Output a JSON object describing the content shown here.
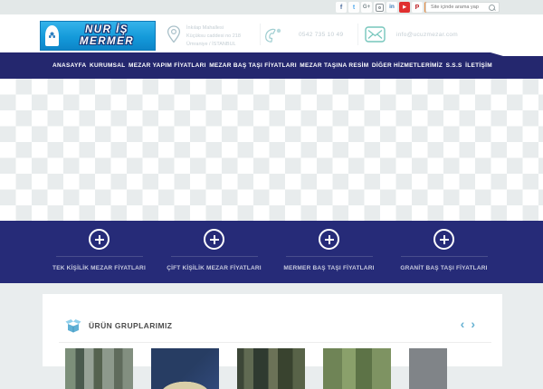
{
  "colors": {
    "accent_blue": "#29abe2",
    "navy": "#24276e",
    "feature_navy": "#262b78",
    "teal_icon": "#76c6bc",
    "light_blue_ui": "#66b1d2"
  },
  "topbar": {
    "search_placeholder": "Site içinde arama yap",
    "social": [
      {
        "name": "facebook-icon",
        "glyph": "f"
      },
      {
        "name": "twitter-icon",
        "glyph": "t"
      },
      {
        "name": "googleplus-icon",
        "glyph": "G+"
      },
      {
        "name": "instagram-icon",
        "glyph": ""
      },
      {
        "name": "linkedin-icon",
        "glyph": "in"
      },
      {
        "name": "youtube-icon",
        "glyph": "▶"
      },
      {
        "name": "pinterest-icon",
        "glyph": "P"
      },
      {
        "name": "rss-icon",
        "glyph": ""
      }
    ]
  },
  "header": {
    "logo_line1": "NUR İŞ",
    "logo_line2": "MERMER",
    "address_line1": "İnkılap Mahallesi",
    "address_line2": "Küçüksu caddesi no 218",
    "address_line3": "Ümraniye / İSTANBUL",
    "phone": "0542 735 10 49",
    "email": "info@ucuzmezar.com"
  },
  "nav": {
    "items": [
      "ANASAYFA",
      "KURUMSAL",
      "MEZAR YAPIM FİYATLARI",
      "MEZAR BAŞ TAŞI FİYATLARI",
      "MEZAR TAŞINA RESİM",
      "DİĞER HİZMETLERİMİZ",
      "S.S.S",
      "İLETİŞİM"
    ]
  },
  "features": {
    "items": [
      "TEK KİŞİLİK MEZAR FİYATLARI",
      "ÇİFT KİŞİLİK MEZAR FİYATLARI",
      "MERMER BAŞ TAŞI FİYATLARI",
      "GRANİT BAŞ TAŞI FİYATLARI"
    ]
  },
  "products": {
    "title": "ÜRÜN GRUPLARIMIZ",
    "prev_glyph": "‹",
    "next_glyph": "›"
  }
}
